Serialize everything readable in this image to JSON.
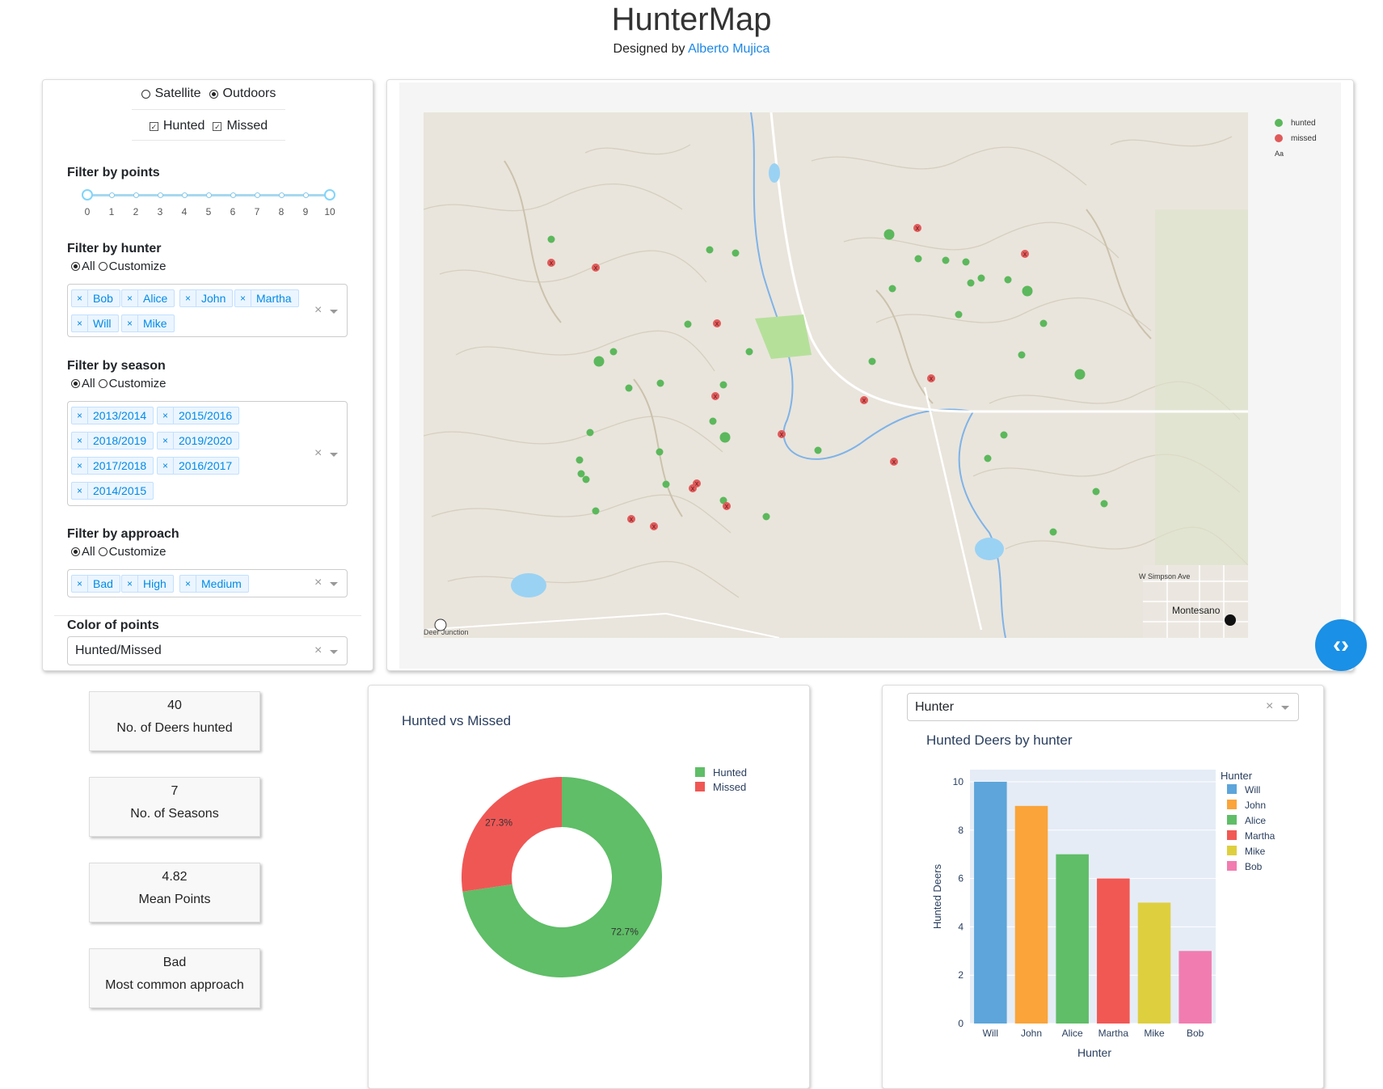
{
  "header": {
    "title": "HunterMap",
    "subtitle_prefix": "Designed by",
    "author": "Alberto Mujica"
  },
  "filters": {
    "map_style": {
      "options": [
        "Satellite",
        "Outdoors"
      ],
      "selected": "Outdoors"
    },
    "point_types": {
      "options": [
        "Hunted",
        "Missed"
      ],
      "checked": [
        "Hunted",
        "Missed"
      ]
    },
    "points": {
      "title": "Filter by points",
      "marks": [
        "0",
        "1",
        "2",
        "3",
        "4",
        "5",
        "6",
        "7",
        "8",
        "9",
        "10"
      ],
      "range": [
        0,
        10
      ]
    },
    "hunter": {
      "title": "Filter by hunter",
      "radio": [
        "All",
        "Customize"
      ],
      "selected": "All",
      "tags": [
        "Bob",
        "Alice",
        "John",
        "Martha",
        "Will",
        "Mike"
      ]
    },
    "season": {
      "title": "Filter by season",
      "radio": [
        "All",
        "Customize"
      ],
      "selected": "All",
      "tags": [
        "2013/2014",
        "2015/2016",
        "2018/2019",
        "2019/2020",
        "2017/2018",
        "2016/2017",
        "2014/2015"
      ]
    },
    "approach": {
      "title": "Filter by approach",
      "radio": [
        "All",
        "Customize"
      ],
      "selected": "All",
      "tags": [
        "Bad",
        "High",
        "Medium"
      ]
    },
    "color": {
      "title": "Color of points",
      "value": "Hunted/Missed"
    }
  },
  "map": {
    "legend": [
      {
        "label": "hunted",
        "color": "#5cb85c"
      },
      {
        "label": "missed",
        "color": "#e05a5a"
      }
    ],
    "legend_extra": "Aa",
    "labels": {
      "road": "W Simpson Ave",
      "town": "Montesano",
      "corner": "Deer Junction"
    }
  },
  "stats": [
    {
      "value": "40",
      "label": "No. of Deers hunted"
    },
    {
      "value": "7",
      "label": "No. of Seasons"
    },
    {
      "value": "4.82",
      "label": "Mean Points"
    },
    {
      "value": "Bad",
      "label": "Most common approach"
    }
  ],
  "pie": {
    "title": "Hunted vs Missed",
    "chart_data": {
      "type": "pie",
      "labels": [
        "Hunted",
        "Missed"
      ],
      "values": [
        72.7,
        27.3
      ],
      "colors": [
        "#5fbe67",
        "#ef5755"
      ],
      "value_labels": [
        "72.7%",
        "27.3%"
      ],
      "hole": true
    }
  },
  "bar": {
    "dropdown": "Hunter",
    "title": "Hunted Deers by hunter",
    "chart_data": {
      "type": "bar",
      "categories": [
        "Will",
        "John",
        "Alice",
        "Martha",
        "Mike",
        "Bob"
      ],
      "values": [
        10,
        9,
        7,
        6,
        5,
        3
      ],
      "colors": [
        "#5da5da",
        "#faa43a",
        "#60bd68",
        "#f15854",
        "#decf3f",
        "#f17cb0"
      ],
      "xlabel": "Hunter",
      "ylabel": "Hunted Deers",
      "ylim": [
        0,
        10.5
      ],
      "yticks": [
        0,
        2,
        4,
        6,
        8,
        10
      ],
      "legend_title": "Hunter"
    }
  }
}
